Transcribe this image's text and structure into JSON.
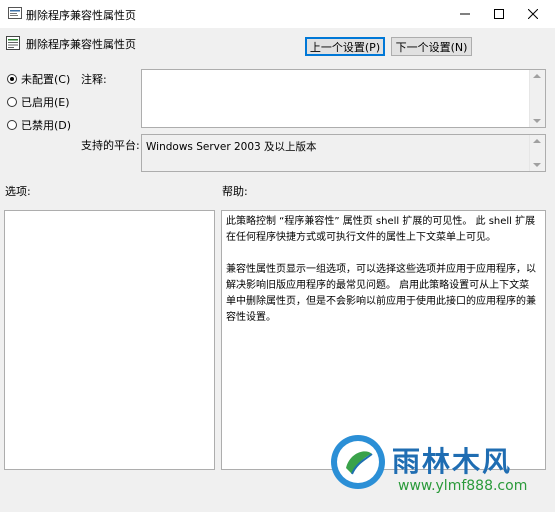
{
  "window": {
    "title": "删除程序兼容性属性页"
  },
  "header": {
    "policy_name": "删除程序兼容性属性页"
  },
  "nav": {
    "prev_label": "上一个设置(P)",
    "next_label": "下一个设置(N)"
  },
  "state": {
    "options": [
      {
        "label": "未配置(C)",
        "checked": true
      },
      {
        "label": "已启用(E)",
        "checked": false
      },
      {
        "label": "已禁用(D)",
        "checked": false
      }
    ]
  },
  "comment": {
    "label": "注释:",
    "value": ""
  },
  "platform": {
    "label": "支持的平台:",
    "value": "Windows Server 2003 及以上版本"
  },
  "options_panel": {
    "label": "选项:"
  },
  "help_panel": {
    "label": "帮助:",
    "paragraphs": [
      "此策略控制 “程序兼容性” 属性页 shell 扩展的可见性。 此 shell 扩展在任何程序快捷方式或可执行文件的属性上下文菜单上可见。",
      "兼容性属性页显示一组选项，可以选择这些选项并应用于应用程序，以解决影响旧版应用程序的最常见问题。 启用此策略设置可从上下文菜单中删除属性页，但是不会影响以前应用于使用此接口的应用程序的兼容性设置。"
    ]
  },
  "watermark": {
    "title": "雨林木风",
    "url": "www.ylmf888.com"
  },
  "colors": {
    "accent": "#0078d7",
    "watermark_blue": "#1f6db2",
    "watermark_green": "#2a9a3a"
  }
}
